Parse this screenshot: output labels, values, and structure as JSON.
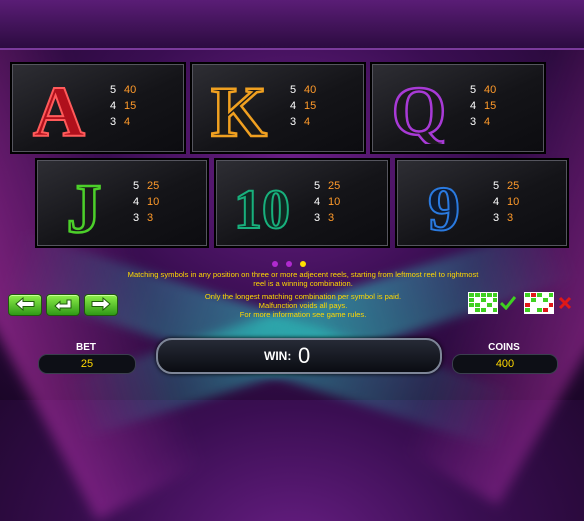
{
  "paytable": {
    "symbols": [
      {
        "name": "A",
        "color": "#c0102a",
        "pays": [
          {
            "count": "5",
            "value": "40"
          },
          {
            "count": "4",
            "value": "15"
          },
          {
            "count": "3",
            "value": "4"
          }
        ]
      },
      {
        "name": "K",
        "color": "#e8a020",
        "pays": [
          {
            "count": "5",
            "value": "40"
          },
          {
            "count": "4",
            "value": "15"
          },
          {
            "count": "3",
            "value": "4"
          }
        ]
      },
      {
        "name": "Q",
        "color": "#9a2ec0",
        "pays": [
          {
            "count": "5",
            "value": "40"
          },
          {
            "count": "4",
            "value": "15"
          },
          {
            "count": "3",
            "value": "4"
          }
        ]
      },
      {
        "name": "J",
        "color": "#4ac82a",
        "pays": [
          {
            "count": "5",
            "value": "25"
          },
          {
            "count": "4",
            "value": "10"
          },
          {
            "count": "3",
            "value": "3"
          }
        ]
      },
      {
        "name": "10",
        "color": "#16a070",
        "pays": [
          {
            "count": "5",
            "value": "25"
          },
          {
            "count": "4",
            "value": "10"
          },
          {
            "count": "3",
            "value": "3"
          }
        ]
      },
      {
        "name": "9",
        "color": "#1e6ad0",
        "pays": [
          {
            "count": "5",
            "value": "25"
          },
          {
            "count": "4",
            "value": "10"
          },
          {
            "count": "3",
            "value": "3"
          }
        ]
      }
    ]
  },
  "pagination": {
    "pages": 3,
    "current": 3
  },
  "rules": {
    "line1": "Matching symbols in any position on three or more adjecent reels, starting from leftmost reel to rightmost",
    "line2": "reel is a winning combination.",
    "line3": "Only the longest matching combination per symbol is paid.",
    "line4": "Malfunction voids all pays.",
    "line5": "For more information see game rules."
  },
  "nav": {
    "prev_icon": "arrow-left-icon",
    "back_icon": "return-icon",
    "next_icon": "arrow-right-icon"
  },
  "legend": {
    "valid_icon": "check-icon",
    "invalid_icon": "cross-icon",
    "valid_color": "#3fd020",
    "invalid_color": "#e01818"
  },
  "bet": {
    "label": "BET",
    "value": "25"
  },
  "win": {
    "label": "WIN:",
    "value": "0"
  },
  "coins": {
    "label": "COINS",
    "value": "400"
  }
}
